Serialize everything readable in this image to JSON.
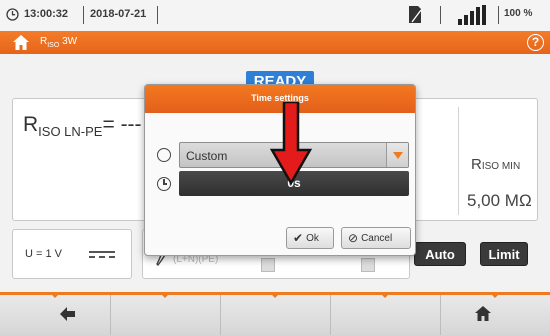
{
  "status_bar": {
    "time": "13:00:32",
    "date": "2018-07-21",
    "battery_percent": "100 %",
    "icons": [
      "clock-icon",
      "sim-card-icon",
      "signal-bars-icon",
      "battery-icon",
      "plug-icon"
    ]
  },
  "title_bar": {
    "title_main": "R",
    "title_sub": "ISO",
    "title_suffix": " 3W",
    "help_label": "?",
    "accent_color": "#f07a1f"
  },
  "badge": {
    "label": "READY"
  },
  "result": {
    "lnpe_main": "R",
    "lnpe_sub": "ISO LN-PE",
    "lnpe_value": "= ---",
    "min_main": "R",
    "min_sub": "ISO MIN",
    "min_value": "5,00 MΩ"
  },
  "params": {
    "voltage": "U = 1 V",
    "mid_text": "(L+N)(PE)",
    "auto_label": "Auto",
    "limit_label": "Limit"
  },
  "modal": {
    "title": "Time settings",
    "mode_value": "Custom",
    "time_value": "0s",
    "ok_label": "Ok",
    "cancel_label": "Cancel"
  },
  "nav": {
    "back_icon": "arrow-left-icon",
    "home_icon": "home-icon"
  }
}
